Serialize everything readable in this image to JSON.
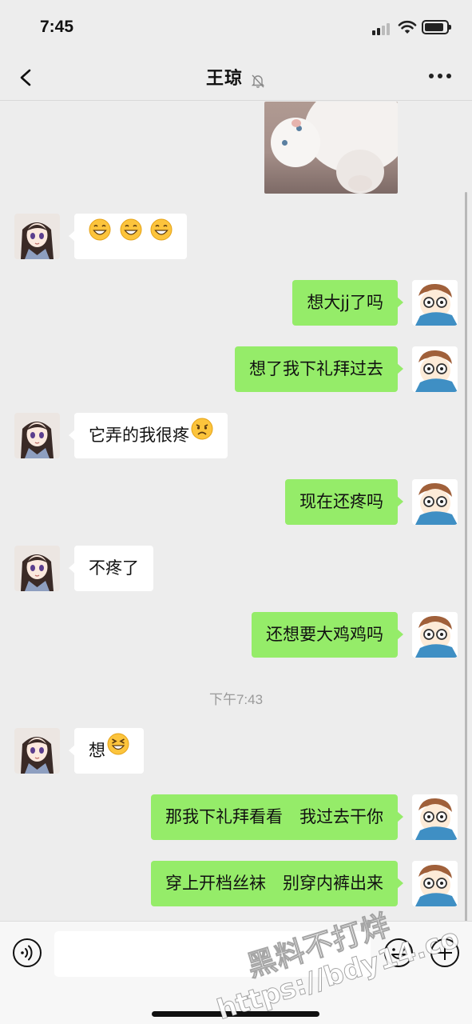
{
  "status_bar": {
    "time": "7:45"
  },
  "header": {
    "title": "王琼"
  },
  "messages": [
    {
      "side": "left",
      "text": ""
    },
    {
      "side": "right",
      "text": "想大jj了吗"
    },
    {
      "side": "right",
      "text": "想了我下礼拜过去"
    },
    {
      "side": "left",
      "text": "它弄的我很疼"
    },
    {
      "side": "right",
      "text": "现在还疼吗"
    },
    {
      "side": "left",
      "text": "不疼了"
    },
    {
      "side": "right",
      "text": "还想要大鸡鸡吗"
    },
    {
      "side": "left",
      "text": "想"
    },
    {
      "side": "right",
      "text": "那我下礼拜看看　我过去干你"
    },
    {
      "side": "right",
      "text": "穿上开档丝袜　别穿内裤出来"
    }
  ],
  "timestamp": "下午7:43",
  "watermark": {
    "line1": "黑料不打烊",
    "line2": "https://bdy14.co"
  },
  "colors": {
    "background": "#ededed",
    "bubble_self": "#95ec69",
    "bubble_other": "#ffffff",
    "timestamp": "#9a9a9a"
  },
  "icons": [
    "back-arrow-icon",
    "mute-bell-icon",
    "more-dots-icon",
    "voice-icon",
    "emoji-icon",
    "plus-icon",
    "grin-emoji",
    "frown-emoji",
    "squint-grin-emoji"
  ]
}
